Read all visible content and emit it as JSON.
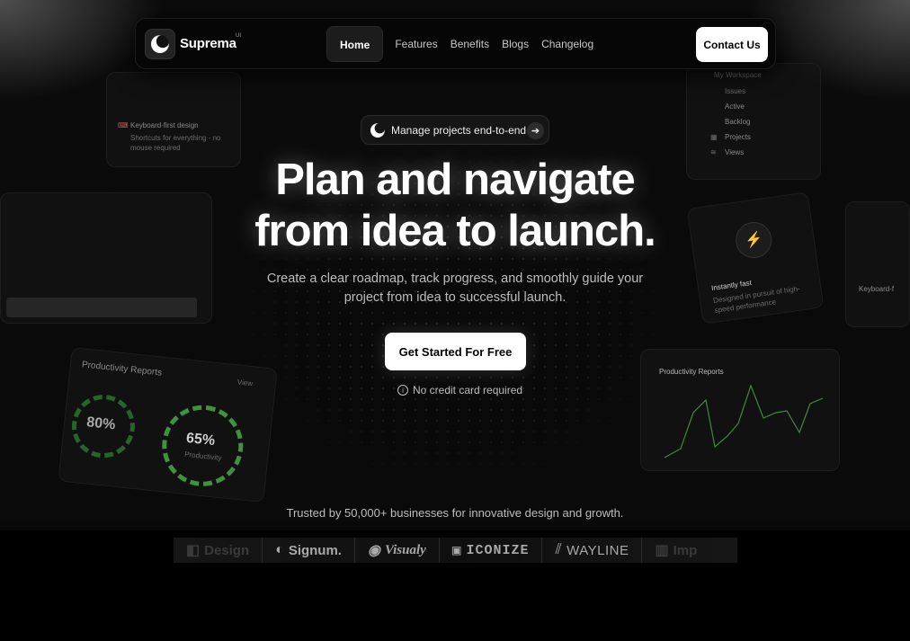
{
  "nav": {
    "brand": "Suprema",
    "brand_sup": "UI",
    "links": [
      "Home",
      "Features",
      "Benefits",
      "Blogs",
      "Changelog"
    ],
    "contact_label": "Contact Us"
  },
  "hero": {
    "pill_label": "Manage projects end-to-end",
    "headline_line1": "Plan and navigate",
    "headline_line2": "from idea to launch.",
    "subtext": "Create a clear roadmap, track progress, and smoothly guide your project from idea to successful launch.",
    "cta_label": "Get Started For Free",
    "note": "No credit card required"
  },
  "trusted": {
    "text": "Trusted by 50,000+ businesses for innovative design and growth.",
    "logos": [
      "Design",
      "Signum.",
      "Visualy",
      "ICONIZE",
      "WAYLINE",
      "Imp"
    ]
  },
  "decor": {
    "kb_card_title": "Keyboard-first design",
    "kb_card_desc1": "Shortcuts for everything - no",
    "kb_card_desc2": "mouse required",
    "prod_title": "Productivity Reports",
    "prod_view": "View",
    "gauge1": "80%",
    "gauge2": "65%",
    "gauge2_label": "Productivity",
    "workspace": "My Workspace",
    "issues": "Issues",
    "active": "Active",
    "backlog": "Backlog",
    "projects": "Projects",
    "views": "Views",
    "fast_title": "Instantly fast",
    "fast_desc1": "Designed in pursuit of high-",
    "fast_desc2": "speed performance",
    "kb2_title": "Keyboard-f",
    "chart_title": "Productivity Reports"
  },
  "colors": {
    "accent": "#ffffff",
    "background": "#0a0a0a",
    "gauge": "#3caa3c"
  }
}
